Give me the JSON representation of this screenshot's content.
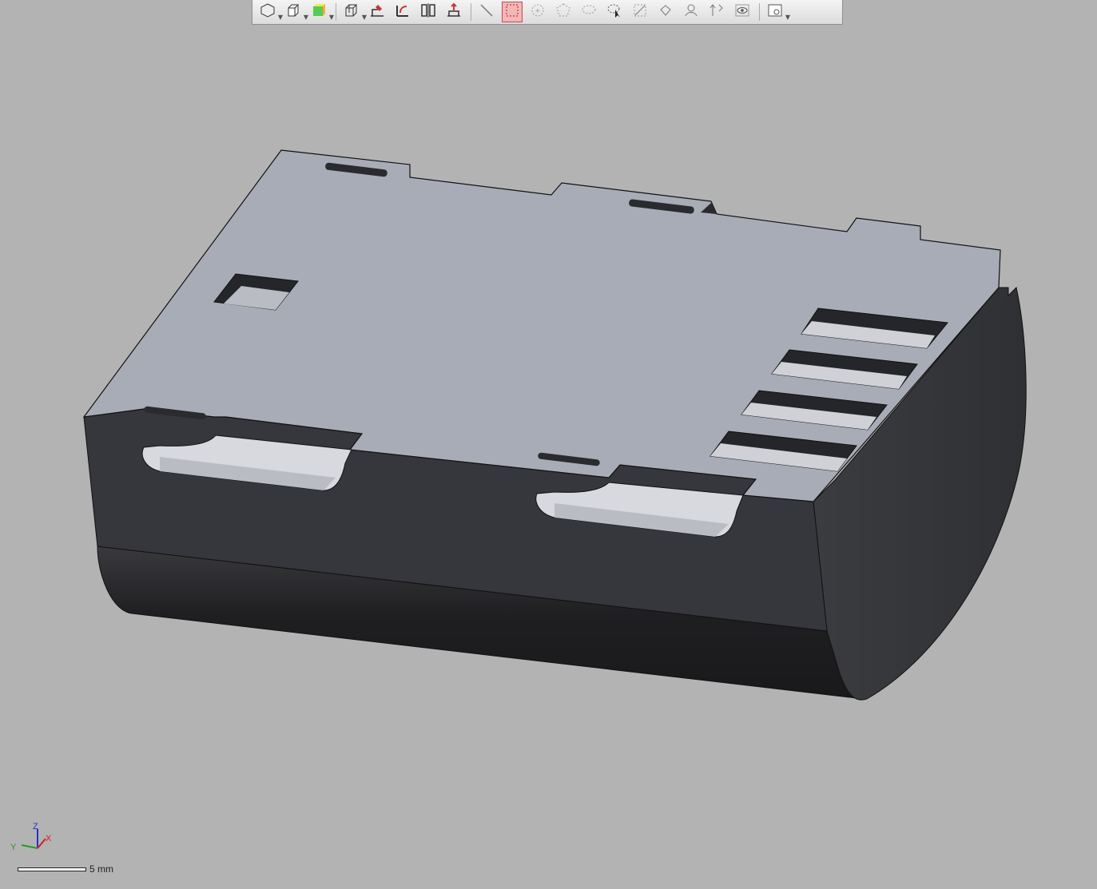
{
  "toolbar": {
    "buttons": [
      {
        "icon": "view-orientation-icon",
        "has_menu": true
      },
      {
        "icon": "display-style-icon",
        "has_menu": true
      },
      {
        "icon": "shaded-appearance-icon",
        "has_menu": true
      },
      {
        "icon": "section-view-icon",
        "has_menu": true
      },
      {
        "icon": "sketch-icon",
        "has_menu": false
      },
      {
        "icon": "dimension-icon",
        "has_menu": false
      },
      {
        "icon": "mirror-icon",
        "has_menu": false
      },
      {
        "icon": "move-face-icon",
        "has_menu": false
      },
      {
        "icon": "line-select-icon",
        "has_menu": false
      },
      {
        "icon": "box-select-icon",
        "has_menu": false,
        "active": true
      },
      {
        "icon": "circle-select-icon",
        "has_menu": false
      },
      {
        "icon": "polygon-select-icon",
        "has_menu": false
      },
      {
        "icon": "lasso-select-icon",
        "has_menu": false
      },
      {
        "icon": "select-cursor-icon",
        "has_menu": false
      },
      {
        "icon": "edge-select-icon",
        "has_menu": false
      },
      {
        "icon": "face-select-icon",
        "has_menu": false
      },
      {
        "icon": "body-select-icon",
        "has_menu": false
      },
      {
        "icon": "axis-select-icon",
        "has_menu": false
      },
      {
        "icon": "visibility-eye-icon",
        "has_menu": false
      },
      {
        "icon": "view-options-icon",
        "has_menu": true
      }
    ],
    "accent_color": "#c0392b"
  },
  "triad": {
    "x_label": "X",
    "y_label": "Y",
    "z_label": "Z"
  },
  "scale": {
    "label": "5 mm"
  }
}
